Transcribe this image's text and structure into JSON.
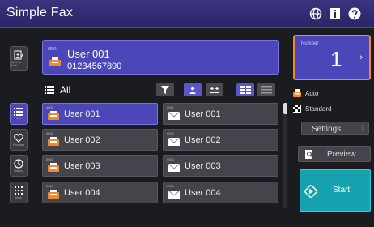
{
  "header": {
    "title": "Simple Fax"
  },
  "left_nav": {
    "address_book": "Address Book",
    "list": "List",
    "favorites": "Favorites",
    "history": "History",
    "keys": "Keys"
  },
  "selected": {
    "number": "0001",
    "name": "User 001",
    "phone": "01234567890"
  },
  "filter": {
    "label": "All"
  },
  "entries": [
    {
      "num": "0001",
      "name": "User 001",
      "selected": true,
      "type": "fax"
    },
    {
      "num": "0001",
      "name": "User 001",
      "selected": false,
      "type": "email"
    },
    {
      "num": "0002",
      "name": "User 002",
      "selected": false,
      "type": "fax"
    },
    {
      "num": "0002",
      "name": "User 002",
      "selected": false,
      "type": "email"
    },
    {
      "num": "0003",
      "name": "User 003",
      "selected": false,
      "type": "fax"
    },
    {
      "num": "0003",
      "name": "User 003",
      "selected": false,
      "type": "email"
    },
    {
      "num": "0004",
      "name": "User 004",
      "selected": false,
      "type": "fax"
    },
    {
      "num": "0004",
      "name": "User 004",
      "selected": false,
      "type": "email"
    }
  ],
  "number_panel": {
    "label": "Number",
    "value": "1"
  },
  "options": {
    "auto": "Auto",
    "standard": "Standard",
    "settings": "Settings"
  },
  "preview": "Preview",
  "start": "Start",
  "colors": {
    "accent": "#4c47b8",
    "start": "#17a2b0",
    "highlight": "#f08a2a"
  }
}
